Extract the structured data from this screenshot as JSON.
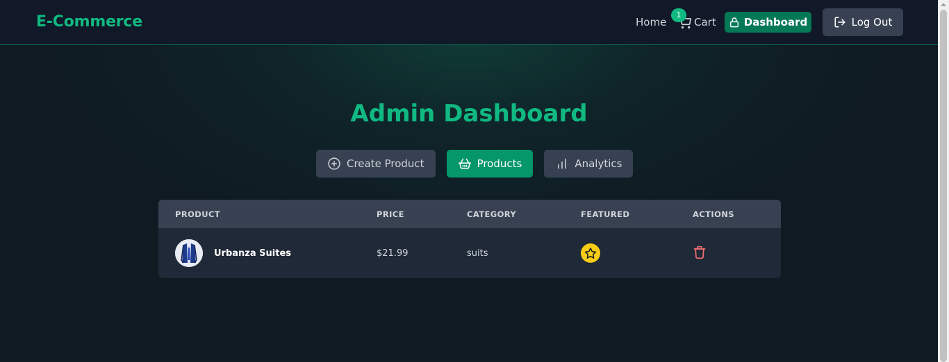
{
  "navbar": {
    "brand": "E-Commerce",
    "home_label": "Home",
    "cart_label": "Cart",
    "cart_count": "1",
    "dashboard_label": "Dashboard",
    "logout_label": "Log Out"
  },
  "page": {
    "title": "Admin Dashboard"
  },
  "tabs": [
    {
      "label": "Create Product",
      "icon": "plus-circle-icon",
      "active": false
    },
    {
      "label": "Products",
      "icon": "basket-icon",
      "active": true
    },
    {
      "label": "Analytics",
      "icon": "bar-chart-icon",
      "active": false
    }
  ],
  "table": {
    "headers": [
      "PRODUCT",
      "PRICE",
      "CATEGORY",
      "FEATURED",
      "ACTIONS"
    ],
    "rows": [
      {
        "name": "Urbanza Suites",
        "price": "$21.99",
        "category": "suits",
        "featured": true
      }
    ]
  },
  "colors": {
    "accent": "#10b981",
    "active_tab": "#059669",
    "dashboard_button": "#047857",
    "featured_star": "#facc15",
    "delete": "#f87171"
  }
}
